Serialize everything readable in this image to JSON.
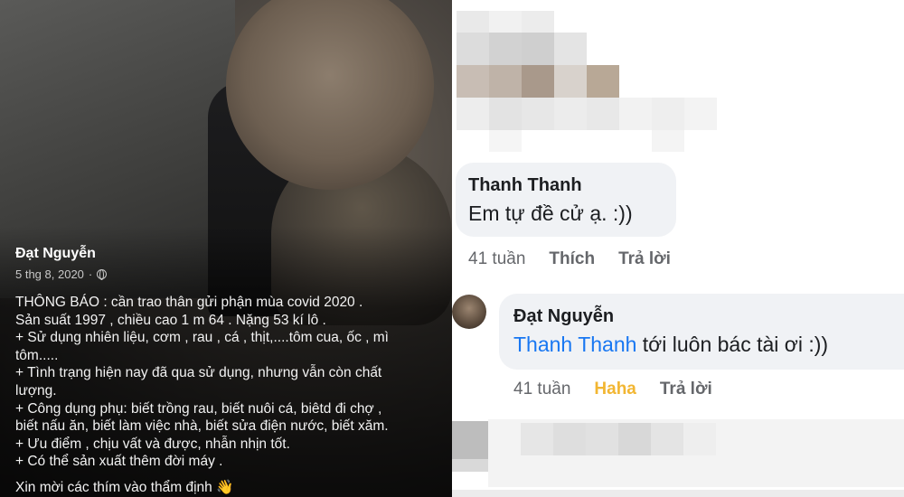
{
  "post": {
    "author": "Đạt Nguyễn",
    "date": "5 thg 8, 2020",
    "separator": "·",
    "privacy_icon": "globe-icon",
    "lines": [
      "THÔNG BÁO : cần trao thân gửi phận mùa covid 2020 .",
      "Sản suất 1997 , chiều cao 1 m 64 . Nặng 53 kí lô .",
      "+ Sử dụng nhiên liệu, cơm , rau , cá , thịt,....tôm cua, ốc , mì",
      "tôm.....",
      "+ Tình trạng hiện nay đã qua sử dụng, nhưng vẫn còn chất",
      "lượng.",
      "+ Công dụng phụ: biết trồng rau, biết nuôi cá, biêtd đi chợ ,",
      "biết nấu ăn, biết làm việc nhà, biết sửa điện nước, biết xăm.",
      "+ Ưu điểm , chịu vất và được, nhẫn nhịn tốt.",
      "+ Có thể sản xuất thêm đời máy ."
    ],
    "closing": "Xin mời các thím vào thẩm định 👋"
  },
  "comments": [
    {
      "author": "Thanh Thanh",
      "text": "Em tự đề cử ạ. :))",
      "time": "41 tuần",
      "like_label": "Thích",
      "reply_label": "Trả lời"
    },
    {
      "author": "Đạt Nguyễn",
      "mention": "Thanh Thanh",
      "text": " tới luôn bác tài ơi :))",
      "time": "41 tuần",
      "reaction_label": "Haha",
      "reply_label": "Trả lời"
    }
  ],
  "colors": {
    "comment_bubble": "#f0f2f5",
    "mention": "#1877f2",
    "haha": "#f2b632",
    "meta_gray": "#65676b"
  }
}
